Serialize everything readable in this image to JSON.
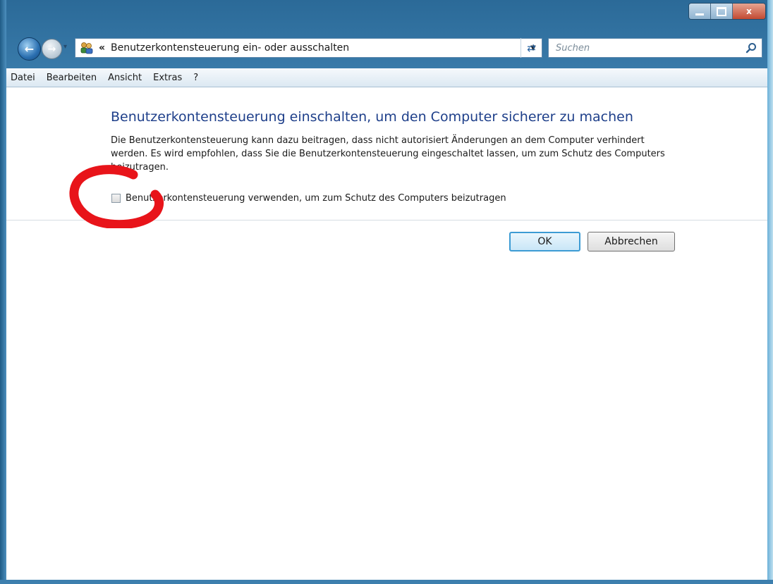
{
  "window": {
    "title_buttons": {
      "minimize": "–",
      "maximize": "□",
      "close": "x"
    }
  },
  "nav": {
    "back_icon": "back-arrow-icon",
    "forward_icon": "forward-arrow-icon",
    "address": {
      "chevron": "«",
      "text": "Benutzerkontensteuerung ein- oder ausschalten"
    },
    "search": {
      "placeholder": "Suchen"
    }
  },
  "menu": {
    "items": [
      "Datei",
      "Bearbeiten",
      "Ansicht",
      "Extras",
      "?"
    ]
  },
  "main": {
    "heading": "Benutzerkontensteuerung einschalten, um den Computer sicherer zu machen",
    "description": "Die Benutzerkontensteuerung kann dazu beitragen, dass nicht autorisiert Änderungen an dem Computer verhindert werden. Es wird empfohlen, dass Sie die Benutzerkontensteuerung eingeschaltet lassen, um zum Schutz des Computers beizutragen.",
    "checkbox": {
      "label": "Benutzerkontensteuerung verwenden, um zum Schutz des Computers beizutragen",
      "checked": false
    },
    "buttons": {
      "ok": "OK",
      "cancel": "Abbrechen"
    }
  },
  "colors": {
    "heading": "#1e3f8a",
    "annotation": "#e8141a"
  }
}
